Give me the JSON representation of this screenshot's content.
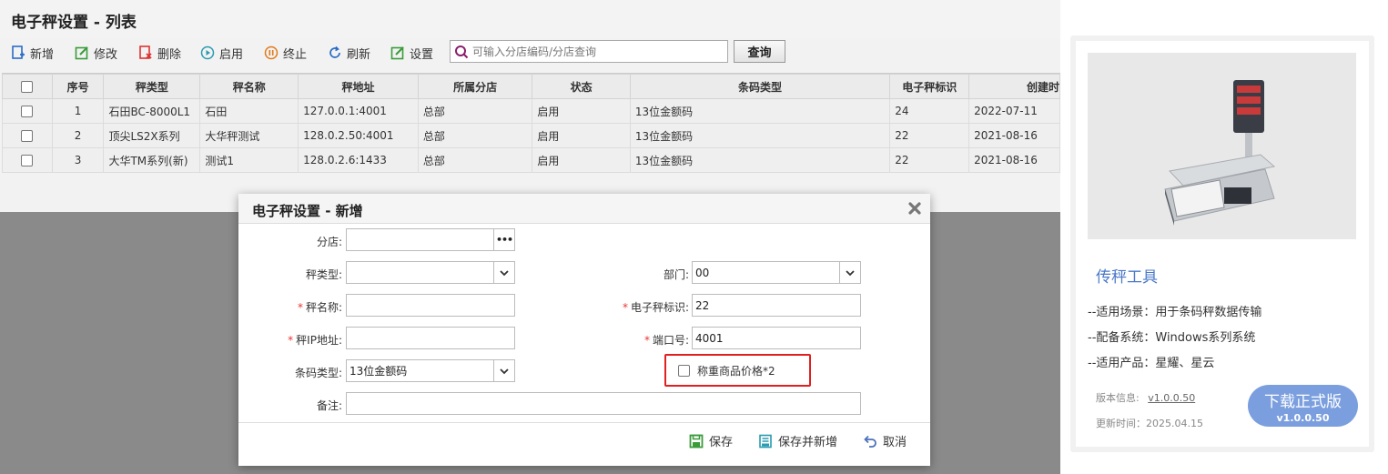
{
  "page_title": "电子秤设置 - 列表",
  "toolbar": {
    "add": "新增",
    "edit": "修改",
    "delete": "删除",
    "enable": "启用",
    "stop": "终止",
    "refresh": "刷新",
    "settings": "设置",
    "search_placeholder": "可输入分店编码/分店查询",
    "query": "查询"
  },
  "table": {
    "headers": [
      "序号",
      "秤类型",
      "秤名称",
      "秤地址",
      "所属分店",
      "状态",
      "条码类型",
      "电子秤标识",
      "创建时"
    ],
    "rows": [
      [
        "1",
        "石田BC-8000L1",
        "石田",
        "127.0.0.1:4001",
        "总部",
        "启用",
        "13位金额码",
        "24",
        "2022-07-11"
      ],
      [
        "2",
        "顶尖LS2X系列",
        "大华秤测试",
        "128.0.2.50:4001",
        "总部",
        "启用",
        "13位金额码",
        "22",
        "2021-08-16"
      ],
      [
        "3",
        "大华TM系列(新)",
        "测试1",
        "128.0.2.6:1433",
        "总部",
        "启用",
        "13位金额码",
        "22",
        "2021-08-16"
      ]
    ]
  },
  "dialog": {
    "title": "电子秤设置 - 新增",
    "labels": {
      "branch": "分店:",
      "scale_type": "秤类型:",
      "department": "部门:",
      "scale_name": "秤名称:",
      "scale_id": "电子秤标识:",
      "scale_ip": "秤IP地址:",
      "port": "端口号:",
      "barcode_type": "条码类型:",
      "remark": "备注:"
    },
    "values": {
      "branch": "",
      "scale_type": "",
      "department": "00",
      "scale_name": "",
      "scale_id": "22",
      "scale_ip": "",
      "port": "4001",
      "barcode_type": "13位金额码",
      "remark": ""
    },
    "checkbox": "称重商品价格*2",
    "buttons": {
      "save": "保存",
      "save_new": "保存并新增",
      "cancel": "取消"
    }
  },
  "side_card": {
    "title": "传秤工具",
    "lines": [
      "--适用场景：用于条码秤数据传输",
      "--配备系统：Windows系列系统",
      "--适用产品：星耀、星云"
    ],
    "version_label": "版本信息:",
    "version": "v1.0.0.50",
    "update_time": "更新时间：2025.04.15",
    "download_label": "下载正式版",
    "download_version": "v1.0.0.50",
    "accent": "#7b9fde"
  }
}
